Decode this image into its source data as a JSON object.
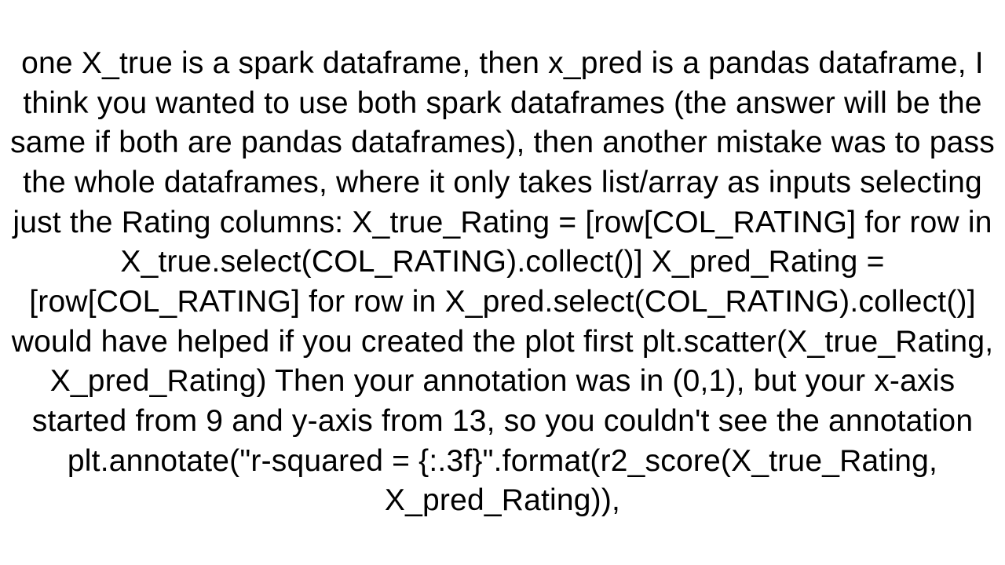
{
  "content": {
    "paragraph": "one X_true is a spark dataframe, then x_pred is a pandas dataframe, I think you wanted to use both spark dataframes (the answer will be the same if both are pandas dataframes), then another mistake was to pass the whole dataframes, where it only takes list/array as inputs selecting just the Rating columns: X_true_Rating = [row[COL_RATING] for row in X_true.select(COL_RATING).collect()] X_pred_Rating = [row[COL_RATING] for row in X_pred.select(COL_RATING).collect()]  would have helped if you created the plot first plt.scatter(X_true_Rating, X_pred_Rating)  Then your annotation was in (0,1), but your x-axis started from 9 and y-axis from 13, so you couldn't see the annotation plt.annotate(\"r-squared = {:.3f}\".format(r2_score(X_true_Rating, X_pred_Rating)),"
  }
}
